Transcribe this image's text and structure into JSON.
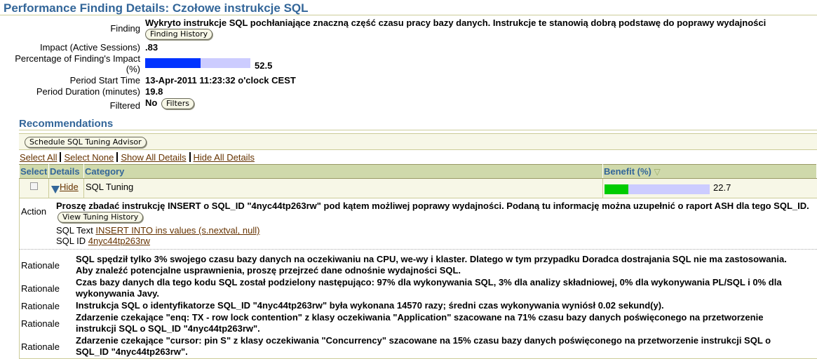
{
  "page": {
    "title": "Performance Finding Details: Czołowe instrukcje SQL"
  },
  "finding": {
    "finding_label": "Finding",
    "finding_value": "Wykryto instrukcje SQL pochłaniające znaczną część czasu pracy bazy danych. Instrukcje te stanowią dobrą podstawę do poprawy wydajności",
    "finding_history_button": "Finding History",
    "impact_label": "Impact (Active Sessions)",
    "impact_value": ".83",
    "percentage_label": "Percentage of Finding's Impact (%)",
    "percentage_value": "52.5",
    "percentage_fraction": 0.525,
    "percentage_color": "#0033ff",
    "start_time_label": "Period Start Time",
    "start_time_value": "13-Apr-2011 11:23:32 o'clock CEST",
    "duration_label": "Period Duration (minutes)",
    "duration_value": "19.8",
    "filtered_label": "Filtered",
    "filtered_value": "No",
    "filters_button": "Filters"
  },
  "recommendations": {
    "title": "Recommendations",
    "schedule_button": "Schedule SQL Tuning Advisor",
    "links": {
      "select_all": "Select All",
      "select_none": "Select None",
      "show_all_details": "Show All Details",
      "hide_all_details": "Hide All Details"
    },
    "columns": {
      "select": "Select",
      "details": "Details",
      "category": "Category",
      "benefit": "Benefit (%)",
      "sort_icon": "▽"
    },
    "rows": [
      {
        "selected": false,
        "details_link": "Hide",
        "category": "SQL Tuning",
        "benefit_value": "22.7",
        "benefit_fraction": 0.227,
        "benefit_color": "#00cc00"
      }
    ],
    "detail": {
      "action_label": "Action",
      "action_text": "Proszę zbadać instrukcję INSERT o SQL_ID \"4nyc44tp263rw\" pod kątem możliwej poprawy wydajności. Podaną tu informację można uzupełnić o raport ASH dla tego SQL_ID.",
      "view_tuning_history_button": "View Tuning History",
      "sql_text_label": "SQL Text",
      "sql_text_value": "INSERT INTO ins values (s.nextval, null)",
      "sql_id_label": "SQL ID",
      "sql_id_value": "4nyc44tp263rw",
      "rationales": [
        {
          "label": "Rationale",
          "text": "SQL spędził tylko 3% swojego czasu bazy danych na oczekiwaniu na CPU, we-wy i klaster. Dlatego w tym przypadku Doradca dostrajania SQL nie ma zastosowania. Aby znaleźć potencjalne usprawnienia, proszę przejrzeć dane odnośnie wydajności SQL."
        },
        {
          "label": "Rationale",
          "text": "Czas bazy danych dla tego kodu SQL został podzielony następująco: 97% dla wykonywania SQL, 3% dla analizy składniowej, 0% dla wykonywania PL/SQL i 0% dla wykonywania Javy."
        },
        {
          "label": "Rationale",
          "text": "Instrukcja SQL o identyfikatorze SQL_ID \"4nyc44tp263rw\" była wykonana 14570 razy; średni czas wykonywania wyniósł 0.02 sekund(y)."
        },
        {
          "label": "Rationale",
          "text": "Zdarzenie czekające \"enq: TX - row lock contention\" z klasy oczekiwania \"Application\" szacowane na 71% czasu bazy danych poświęconego na przetworzenie instrukcji SQL o SQL_ID \"4nyc44tp263rw\"."
        },
        {
          "label": "Rationale",
          "text": "Zdarzenie czekające \"cursor: pin S\" z klasy oczekiwania \"Concurrency\" szacowane na 15% czasu bazy danych poświęconego na przetworzenie instrukcji SQL o SQL_ID \"4nyc44tp263rw\"."
        }
      ]
    }
  }
}
